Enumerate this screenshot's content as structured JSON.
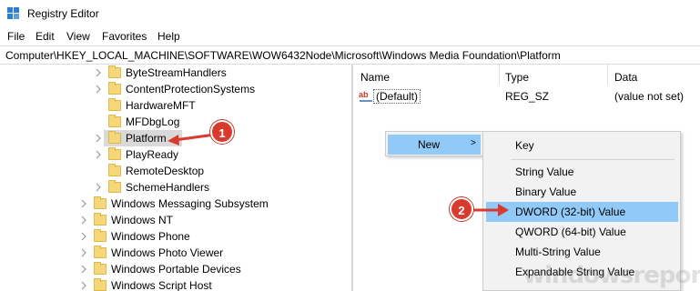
{
  "window": {
    "title": "Registry Editor"
  },
  "menu": [
    "File",
    "Edit",
    "View",
    "Favorites",
    "Help"
  ],
  "address": "Computer\\HKEY_LOCAL_MACHINE\\SOFTWARE\\WOW6432Node\\Microsoft\\Windows Media Foundation\\Platform",
  "tree": {
    "children": [
      "ByteStreamHandlers",
      "ContentProtectionSystems",
      "HardwareMFT",
      "MFDbgLog",
      "Platform",
      "PlayReady",
      "RemoteDesktop",
      "SchemeHandlers"
    ],
    "siblings": [
      "Windows Messaging Subsystem",
      "Windows NT",
      "Windows Phone",
      "Windows Photo Viewer",
      "Windows Portable Devices",
      "Windows Script Host"
    ],
    "selected": "Platform"
  },
  "values": {
    "columns": {
      "name": "Name",
      "type": "Type",
      "data": "Data"
    },
    "rows": [
      {
        "name": "(Default)",
        "type": "REG_SZ",
        "data": "(value not set)"
      }
    ]
  },
  "context_menu": {
    "new_label": "New",
    "new_arrow": ">"
  },
  "submenu": {
    "items": [
      "Key",
      "String Value",
      "Binary Value",
      "DWORD (32-bit) Value",
      "QWORD (64-bit) Value",
      "Multi-String Value",
      "Expandable String Value"
    ],
    "highlighted": "DWORD (32-bit) Value"
  },
  "callouts": [
    "1",
    "2"
  ],
  "colors": {
    "highlight": "#91c9f7",
    "callout": "#d93a2e",
    "folder": "#f6d67a"
  },
  "watermark": "windowsreport"
}
